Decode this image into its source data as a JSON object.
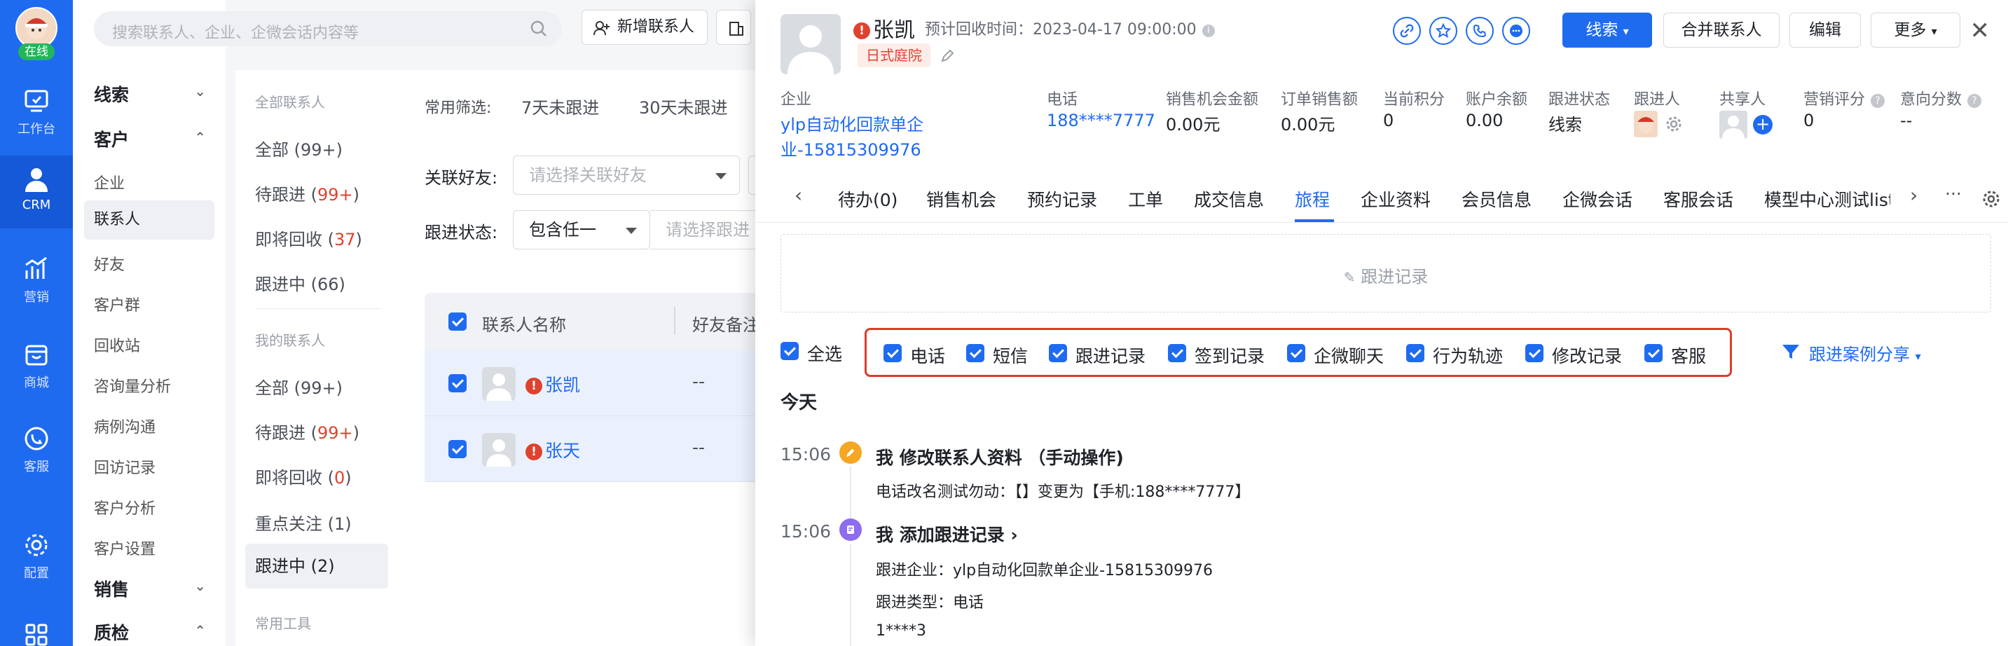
{
  "rail": {
    "online_label": "在线",
    "items": [
      {
        "label": "工作台",
        "icon": "workbench-icon"
      },
      {
        "label": "CRM",
        "icon": "crm-icon"
      },
      {
        "label": "营销",
        "icon": "marketing-icon"
      },
      {
        "label": "商城",
        "icon": "mall-icon"
      },
      {
        "label": "客服",
        "icon": "service-icon"
      },
      {
        "label": "配置",
        "icon": "settings-icon"
      }
    ]
  },
  "topbar": {
    "search_placeholder": "搜索联系人、企业、企微会话内容等",
    "add_contact": "新增联系人"
  },
  "nav": {
    "group_leads": "线索",
    "group_customers": "客户",
    "items": [
      "企业",
      "联系人",
      "好友",
      "客户群",
      "回收站",
      "咨询量分析",
      "病例沟通",
      "回访记录",
      "客户分析",
      "客户设置"
    ],
    "group_sales": "销售",
    "group_qc": "质检"
  },
  "filters": {
    "all_contacts_head": "全部联系人",
    "all": "全部 (99+)",
    "pending_prefix": "待跟进 (",
    "pending_count": "99+",
    "recover_prefix": "即将回收 (",
    "recover_count": "37",
    "following": "跟进中 (66)",
    "my_contacts_head": "我的联系人",
    "my_all": "全部 (99+)",
    "my_pending_prefix": "待跟进 (",
    "my_pending_count": "99+",
    "my_recover_prefix": "即将回收 (",
    "my_recover_count": "0",
    "my_focus": "重点关注 (1)",
    "my_following": "跟进中 (2)",
    "tools_head": "常用工具",
    "close_paren": ")"
  },
  "list": {
    "common_filter_label": "常用筛选:",
    "quick_filters": [
      "7天未跟进",
      "30天未跟进"
    ],
    "friend_label": "关联好友:",
    "friend_placeholder": "请选择关联好友",
    "status_label": "跟进状态:",
    "status_value": "包含任一",
    "status_placeholder": "请选择跟进",
    "col_name": "联系人名称",
    "col_remark": "好友备注",
    "rows": [
      {
        "name": "张凯",
        "remark": "--"
      },
      {
        "name": "张天",
        "remark": "--"
      }
    ]
  },
  "drawer": {
    "name": "张凯",
    "recovery_time": "预计回收时间：2023-04-17 09:00:00",
    "tag": "日式庭院",
    "btn_leads": "线索",
    "btn_merge": "合并联系人",
    "btn_edit": "编辑",
    "btn_more": "更多",
    "fields": {
      "company_label": "企业",
      "company_value_1": "ylp自动化回款单企",
      "company_value_2": "业-15815309976",
      "phone_label": "电话",
      "phone_value": "188****7777",
      "opp_label": "销售机会金额",
      "opp_value": "0.00元",
      "order_label": "订单销售额",
      "order_value": "0.00元",
      "points_label": "当前积分",
      "points_value": "0",
      "balance_label": "账户余额",
      "balance_value": "0.00",
      "status_label": "跟进状态",
      "status_value": "线索",
      "follower_label": "跟进人",
      "sharer_label": "共享人",
      "score_label": "营销评分",
      "score_value": "0",
      "intent_label": "意向分数",
      "intent_value": "--"
    },
    "tabs": [
      "待办(0)",
      "销售机会",
      "预约记录",
      "工单",
      "成交信息",
      "旅程",
      "企业资料",
      "会员信息",
      "企微会话",
      "客服会话",
      "模型中心测试list"
    ],
    "follow_record": "跟进记录",
    "select_all": "全选",
    "checks": [
      "电话",
      "短信",
      "跟进记录",
      "签到记录",
      "企微聊天",
      "行为轨迹",
      "修改记录",
      "客服"
    ],
    "share": "跟进案例分享",
    "day": "今天",
    "timeline": [
      {
        "time": "15:06",
        "title": "我   修改联系人资料 （手动操作)",
        "line1": "电话改名测试勿动：【】变更为【手机:188****7777】"
      },
      {
        "time": "15:06",
        "title": "我 添加跟进记录 ›",
        "line1": "跟进企业：ylp自动化回款单企业-15815309976",
        "line2": "跟进类型：电话",
        "line3": "1****3"
      }
    ]
  },
  "colors": {
    "brand": "#1f6bf0",
    "danger": "#e0412e",
    "online": "#22b55a"
  }
}
